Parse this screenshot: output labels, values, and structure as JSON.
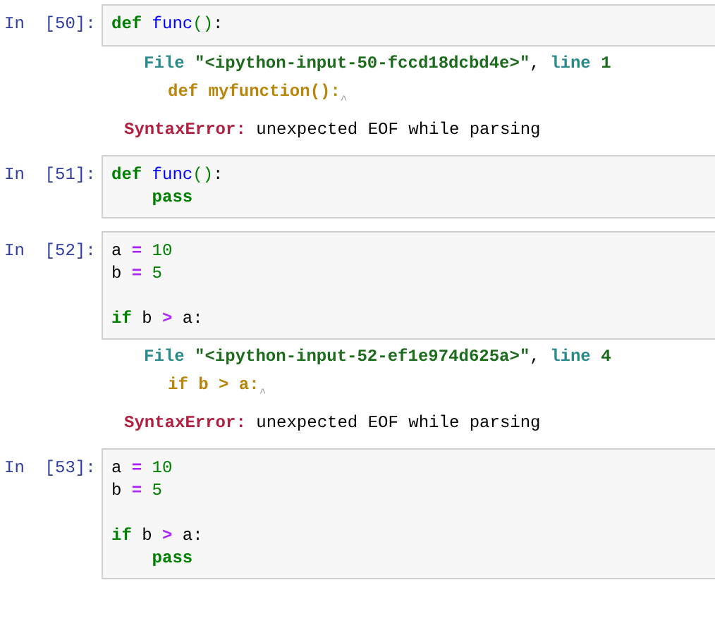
{
  "cells": [
    {
      "prompt": "In  [50]:",
      "lines": [
        {
          "indented": false,
          "tokens": [
            {
              "text": "def",
              "kind": "keyword"
            },
            {
              "text": " func",
              "kind": "name"
            },
            {
              "text": "()",
              "kind": "paren"
            },
            {
              "text": ":",
              "kind": "plain"
            }
          ]
        }
      ],
      "error": {
        "file_line": [
          {
            "text": "File ",
            "kind": "label"
          },
          {
            "text": "″<ipython-input-50-fccd18dcbd4e>″",
            "kind": "string"
          },
          {
            "text": ", ",
            "kind": "plain"
          },
          {
            "text": "line ",
            "kind": "label"
          },
          {
            "text": "1",
            "kind": "string"
          }
        ],
        "source": "def myfunction():",
        "caret": "^",
        "type": "SyntaxError:",
        "message": " unexpected EOF while parsing"
      }
    },
    {
      "prompt": "In  [51]:",
      "lines": [
        {
          "indented": false,
          "tokens": [
            {
              "text": "def",
              "kind": "keyword"
            },
            {
              "text": " func",
              "kind": "name"
            },
            {
              "text": "()",
              "kind": "paren"
            },
            {
              "text": ":",
              "kind": "plain"
            }
          ]
        },
        {
          "indented": true,
          "tokens": [
            {
              "text": "pass",
              "kind": "keyword"
            }
          ]
        }
      ]
    },
    {
      "prompt": "In  [52]:",
      "lines": [
        {
          "indented": false,
          "tokens": [
            {
              "text": "a ",
              "kind": "plain"
            },
            {
              "text": "=",
              "kind": "op"
            },
            {
              "text": " 10",
              "kind": "number"
            }
          ]
        },
        {
          "indented": false,
          "tokens": [
            {
              "text": "b ",
              "kind": "plain"
            },
            {
              "text": "=",
              "kind": "op"
            },
            {
              "text": " 5",
              "kind": "number"
            }
          ]
        },
        {
          "indented": false,
          "blank_before": true,
          "tokens": [
            {
              "text": "if",
              "kind": "keyword"
            },
            {
              "text": " b ",
              "kind": "plain"
            },
            {
              "text": ">",
              "kind": "op"
            },
            {
              "text": " a:",
              "kind": "plain"
            }
          ]
        }
      ],
      "error": {
        "file_line": [
          {
            "text": "File ",
            "kind": "label"
          },
          {
            "text": "″<ipython-input-52-ef1e974d625a>″",
            "kind": "string"
          },
          {
            "text": ", ",
            "kind": "plain"
          },
          {
            "text": "line ",
            "kind": "label"
          },
          {
            "text": "4",
            "kind": "string"
          }
        ],
        "source": "if b > a:",
        "caret": "^",
        "type": "SyntaxError:",
        "message": " unexpected EOF while parsing"
      }
    },
    {
      "prompt": "In  [53]:",
      "lines": [
        {
          "indented": false,
          "tokens": [
            {
              "text": "a ",
              "kind": "plain"
            },
            {
              "text": "=",
              "kind": "op"
            },
            {
              "text": " 10",
              "kind": "number"
            }
          ]
        },
        {
          "indented": false,
          "tokens": [
            {
              "text": "b ",
              "kind": "plain"
            },
            {
              "text": "=",
              "kind": "op"
            },
            {
              "text": " 5",
              "kind": "number"
            }
          ]
        },
        {
          "indented": false,
          "blank_before": true,
          "tokens": [
            {
              "text": "if",
              "kind": "keyword"
            },
            {
              "text": " b ",
              "kind": "plain"
            },
            {
              "text": ">",
              "kind": "op"
            },
            {
              "text": " a:",
              "kind": "plain"
            }
          ]
        },
        {
          "indented": true,
          "tokens": [
            {
              "text": "pass",
              "kind": "keyword"
            }
          ]
        }
      ]
    }
  ]
}
